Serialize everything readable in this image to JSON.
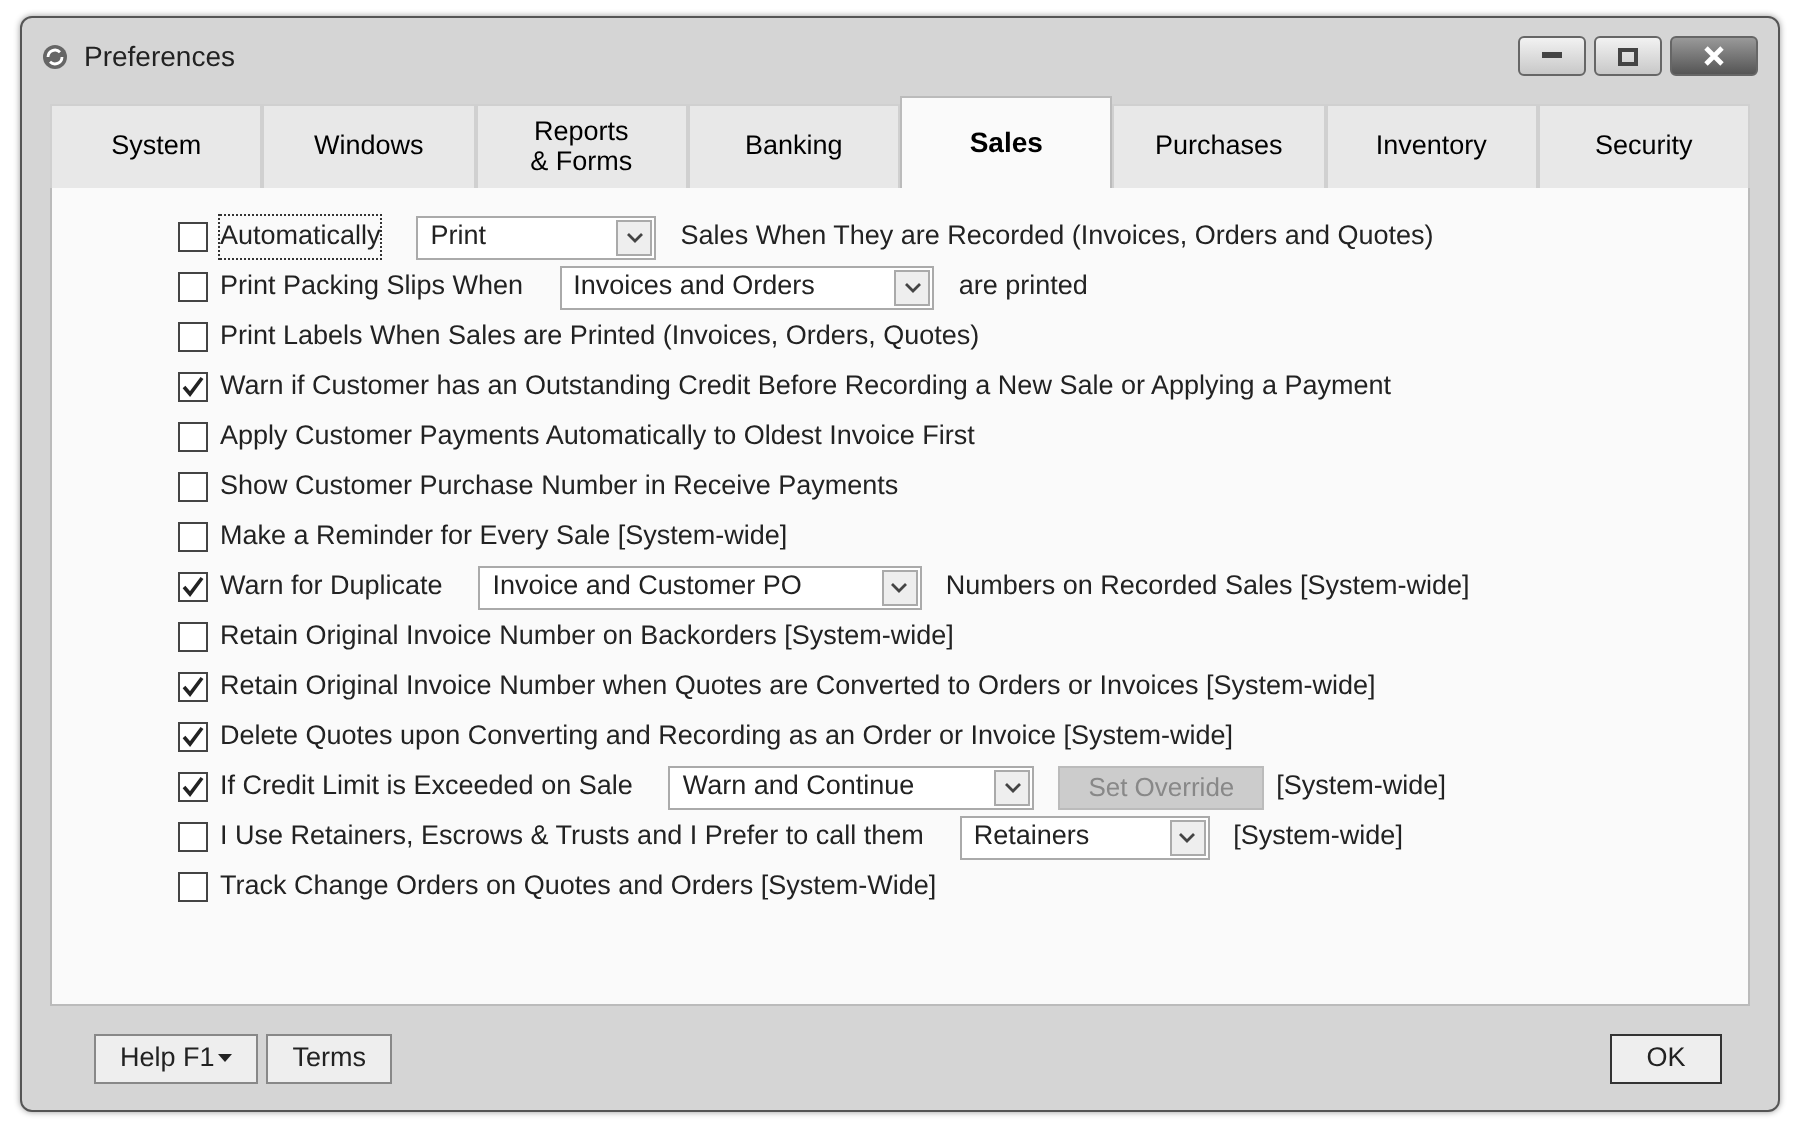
{
  "window": {
    "title": "Preferences"
  },
  "tabs": [
    {
      "label": "System",
      "selected": false
    },
    {
      "label": "Windows",
      "selected": false
    },
    {
      "label": "Reports\n& Forms",
      "selected": false
    },
    {
      "label": "Banking",
      "selected": false
    },
    {
      "label": "Sales",
      "selected": true
    },
    {
      "label": "Purchases",
      "selected": false
    },
    {
      "label": "Inventory",
      "selected": false
    },
    {
      "label": "Security",
      "selected": false
    }
  ],
  "options": [
    {
      "label": "Automatically",
      "checked": false,
      "focused": true,
      "dropdown": {
        "value": "Print"
      },
      "suffix": "Sales When They are Recorded (Invoices, Orders and Quotes)"
    },
    {
      "label": "Print Packing Slips When",
      "checked": false,
      "dropdown": {
        "value": "Invoices and Orders"
      },
      "suffix": "are printed"
    },
    {
      "label": "Print Labels When Sales are Printed (Invoices, Orders, Quotes)",
      "checked": false
    },
    {
      "label": "Warn if Customer has an Outstanding Credit Before Recording a New Sale or Applying a Payment",
      "checked": true
    },
    {
      "label": "Apply Customer Payments Automatically to Oldest Invoice First",
      "checked": false
    },
    {
      "label": "Show Customer Purchase Number in Receive Payments",
      "checked": false
    },
    {
      "label": "Make a Reminder for Every Sale [System-wide]",
      "checked": false
    },
    {
      "label": "Warn for Duplicate",
      "checked": true,
      "dropdown": {
        "value": "Invoice and Customer PO"
      },
      "suffix": "Numbers on Recorded Sales [System-wide]"
    },
    {
      "label": "Retain Original Invoice Number on Backorders [System-wide]",
      "checked": false
    },
    {
      "label": "Retain Original Invoice Number when Quotes are Converted to Orders or Invoices [System-wide]",
      "checked": true
    },
    {
      "label": "Delete Quotes upon Converting and Recording as an Order or Invoice [System-wide]",
      "checked": true
    },
    {
      "label": "If Credit Limit is Exceeded on Sale",
      "checked": true,
      "dropdown": {
        "value": "Warn and Continue"
      },
      "button": {
        "label": "Set Override",
        "disabled": true
      },
      "suffix": "[System-wide]"
    },
    {
      "label": "I Use Retainers, Escrows & Trusts and I Prefer to call them",
      "checked": false,
      "dropdown": {
        "value": "Retainers"
      },
      "suffix": "[System-wide]"
    },
    {
      "label": "Track Change Orders on Quotes and Orders [System-Wide]",
      "checked": false
    }
  ],
  "footer": {
    "left_buttons": [
      {
        "label": "Help F1",
        "menu": true
      },
      {
        "label": "Terms",
        "menu": false
      }
    ],
    "right_button": "OK"
  }
}
